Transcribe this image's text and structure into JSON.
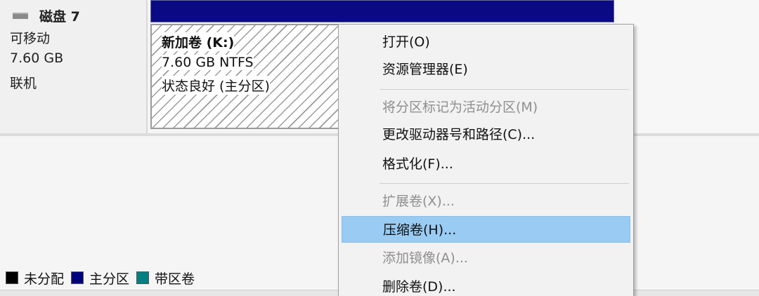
{
  "disk": {
    "title": "磁盘 7",
    "type": "可移动",
    "size": "7.60 GB",
    "status": "联机"
  },
  "volume": {
    "name": "新加卷  (K:)",
    "size_fs": "7.60 GB NTFS",
    "health": "状态良好 (主分区)"
  },
  "context_menu": {
    "items": [
      {
        "label": "打开(O)",
        "disabled": false
      },
      {
        "label": "资源管理器(E)",
        "disabled": false
      },
      {
        "label": "将分区标记为活动分区(M)",
        "disabled": true
      },
      {
        "label": "更改驱动器号和路径(C)...",
        "disabled": false
      },
      {
        "label": "格式化(F)...",
        "disabled": false
      },
      {
        "label": "扩展卷(X)...",
        "disabled": true
      },
      {
        "label": "压缩卷(H)...",
        "disabled": false,
        "highlighted": true
      },
      {
        "label": "添加镜像(A)...",
        "disabled": true
      },
      {
        "label": "删除卷(D)...",
        "disabled": false
      }
    ]
  },
  "legend": {
    "items": [
      {
        "label": "未分配",
        "color": "#000000"
      },
      {
        "label": "主分区",
        "color": "#00007f"
      },
      {
        "label": "带区卷",
        "color": "#008080"
      }
    ]
  },
  "colors": {
    "primary_partition_bar": "#0a0a84",
    "menu_highlight": "#99cbf3"
  }
}
